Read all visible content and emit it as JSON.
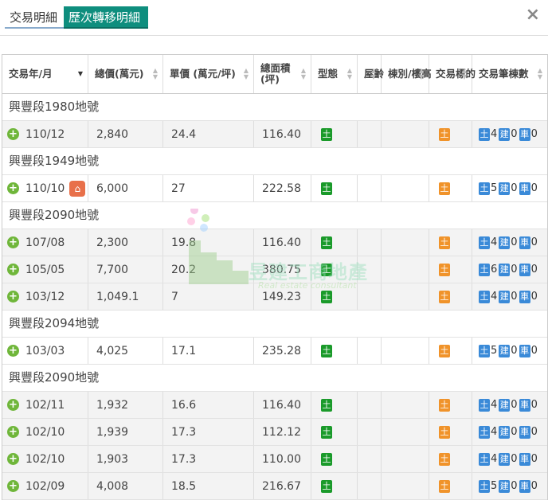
{
  "tabs": [
    "交易明細",
    "歷次轉移明細"
  ],
  "close_icon": "×",
  "headers": [
    {
      "label": "交易年/月"
    },
    {
      "label": "總價(萬元)"
    },
    {
      "label": "單價 (萬元/坪)"
    },
    {
      "label": "總面積\n(坪)"
    },
    {
      "label": "型態"
    },
    {
      "label": "屋齡"
    },
    {
      "label": "棟別/樓高"
    },
    {
      "label": "交易標的"
    },
    {
      "label": "交易筆棟數"
    }
  ],
  "badge_land": "土",
  "badge_building": "建",
  "badge_car": "車",
  "groups": [
    {
      "name": "興豐段1980地號",
      "rows": [
        {
          "date": "110/12",
          "total": "2,840",
          "unit": "24.4",
          "area": "116.40",
          "land": "4",
          "bldg": "0",
          "car": "0"
        }
      ]
    },
    {
      "name": "興豐段1949地號",
      "rows": [
        {
          "date": "110/10",
          "total": "6,000",
          "unit": "27",
          "area": "222.58",
          "land": "5",
          "bldg": "0",
          "car": "0",
          "house_icon": true
        }
      ]
    },
    {
      "name": "興豐段2090地號",
      "rows": [
        {
          "date": "107/08",
          "total": "2,300",
          "unit": "19.8",
          "area": "116.40",
          "land": "4",
          "bldg": "0",
          "car": "0"
        },
        {
          "date": "105/05",
          "total": "7,700",
          "unit": "20.2",
          "area": "380.75",
          "land": "6",
          "bldg": "0",
          "car": "0"
        },
        {
          "date": "103/12",
          "total": "1,049.1",
          "unit": "7",
          "area": "149.23",
          "land": "4",
          "bldg": "0",
          "car": "0"
        }
      ]
    },
    {
      "name": "興豐段2094地號",
      "rows": [
        {
          "date": "103/03",
          "total": "4,025",
          "unit": "17.1",
          "area": "235.28",
          "land": "5",
          "bldg": "0",
          "car": "0"
        }
      ]
    },
    {
      "name": "興豐段2090地號",
      "rows": [
        {
          "date": "102/11",
          "total": "1,932",
          "unit": "16.6",
          "area": "116.40",
          "land": "4",
          "bldg": "0",
          "car": "0"
        },
        {
          "date": "102/10",
          "total": "1,939",
          "unit": "17.3",
          "area": "112.12",
          "land": "4",
          "bldg": "0",
          "car": "0"
        },
        {
          "date": "102/10",
          "total": "1,903",
          "unit": "17.3",
          "area": "110.00",
          "land": "4",
          "bldg": "0",
          "car": "0"
        },
        {
          "date": "102/09",
          "total": "4,008",
          "unit": "18.5",
          "area": "216.67",
          "land": "5",
          "bldg": "0",
          "car": "0"
        }
      ]
    }
  ],
  "watermark": {
    "title": "昱建工商地產",
    "subtitle": "Real estate consultant"
  }
}
